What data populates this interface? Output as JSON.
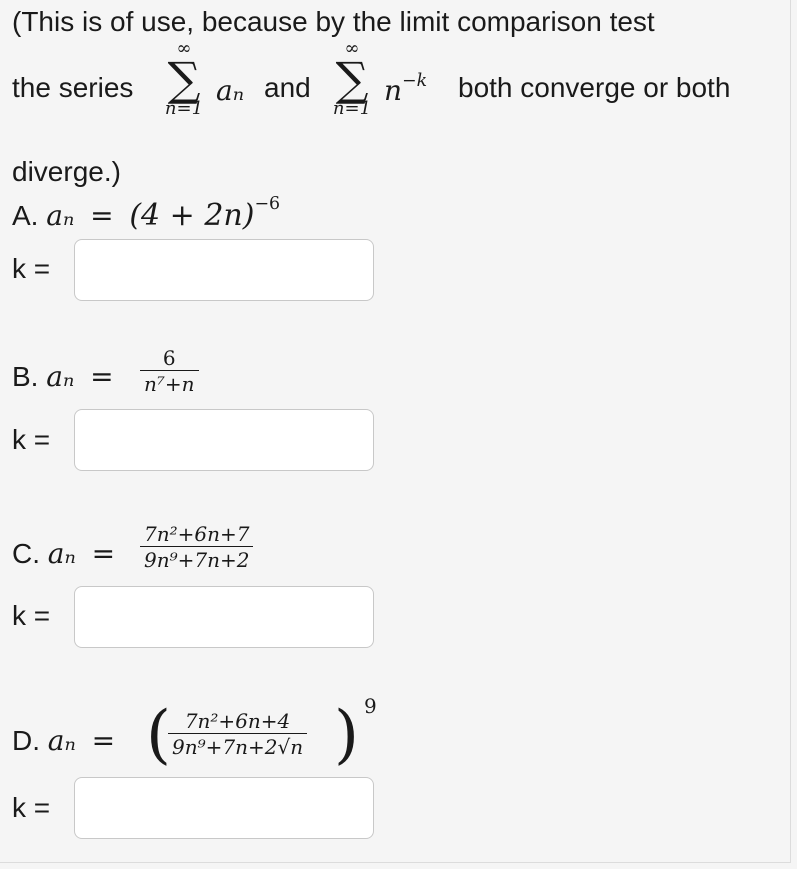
{
  "intro": {
    "line1": "(This is of use, because by the limit comparison test",
    "the_series": "the series",
    "sum1_top": "∞",
    "sum1_bottom": "n=1",
    "sum1_term": "aₙ",
    "and": "and",
    "sum2_top": "∞",
    "sum2_bottom": "n=1",
    "sum2_term": "n",
    "sum2_exp": "−k",
    "both": "both converge or both",
    "line3": "diverge.)"
  },
  "parts": [
    {
      "letter": "A.",
      "an": "aₙ",
      "eq": "=",
      "expr": "(4 + 2n)",
      "exp": "−6",
      "k_label": "k =",
      "k_value": ""
    },
    {
      "letter": "B.",
      "an": "aₙ",
      "eq": "=",
      "num": "6",
      "den": "n⁷+n",
      "k_label": "k =",
      "k_value": ""
    },
    {
      "letter": "C.",
      "an": "aₙ",
      "eq": "=",
      "num": "7n²+6n+7",
      "den": "9n⁹+7n+2",
      "k_label": "k =",
      "k_value": ""
    },
    {
      "letter": "D.",
      "an": "aₙ",
      "eq": "=",
      "num": "7n²+6n+4",
      "den": "9n⁹+7n+2√n",
      "exp": "9",
      "k_label": "k =",
      "k_value": ""
    }
  ]
}
